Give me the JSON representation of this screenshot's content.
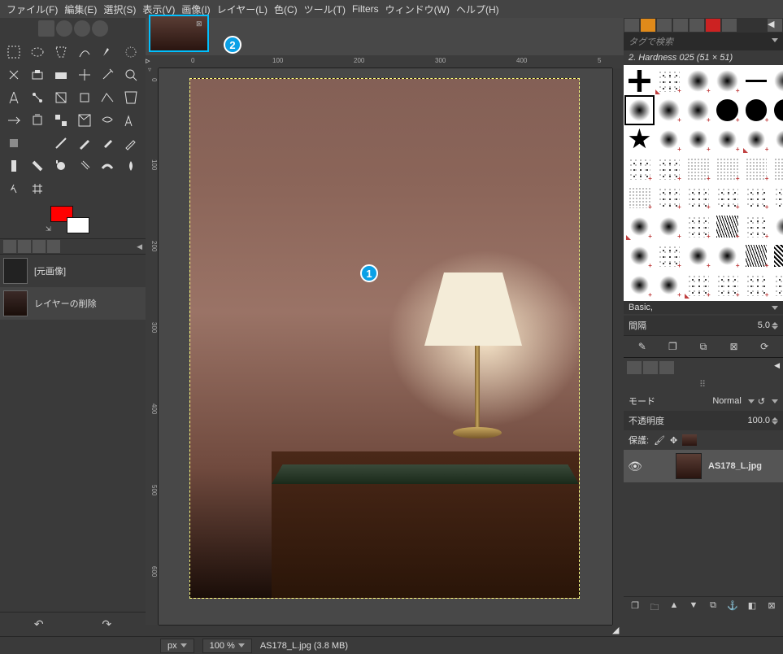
{
  "menu": [
    "ファイル(F)",
    "編集(E)",
    "選択(S)",
    "表示(V)",
    "画像(I)",
    "レイヤー(L)",
    "色(C)",
    "ツール(T)",
    "Filters",
    "ウィンドウ(W)",
    "ヘルプ(H)"
  ],
  "badges": {
    "b1": "1",
    "b2": "2"
  },
  "ruler_h": [
    "0",
    "100",
    "200",
    "300",
    "400",
    "5"
  ],
  "ruler_v": [
    "0",
    "100",
    "200",
    "300",
    "400",
    "500",
    "600"
  ],
  "status": {
    "unit": "px",
    "zoom": "100 %",
    "file": "AS178_L.jpg (3.8 MB)"
  },
  "left_layers": [
    {
      "label": "[元画像]",
      "blank": true
    },
    {
      "label": "レイヤーの削除",
      "blank": false
    }
  ],
  "right": {
    "tag_search": "タグで検索",
    "brush_info": "2. Hardness 025 (51 × 51)",
    "basic": "Basic,",
    "spacing_label": "間隔",
    "spacing_value": "5.0",
    "mode_label": "モード",
    "mode_value": "Normal",
    "opacity_label": "不透明度",
    "opacity_value": "100.0",
    "lock_label": "保護:",
    "layer_name": "AS178_L.jpg"
  },
  "brushes": [
    {
      "t": "b-pix"
    },
    {
      "t": "b-scatter",
      "p": 1,
      "tr": 1
    },
    {
      "t": "b-soft",
      "p": 1
    },
    {
      "t": "b-soft",
      "p": 1
    },
    {
      "t": "b-line"
    },
    {
      "t": "b-soft"
    },
    {
      "t": "b-soft",
      "sel": 1
    },
    {
      "t": "b-soft",
      "p": 1
    },
    {
      "t": "b-soft",
      "p": 1
    },
    {
      "t": "b-hard",
      "p": 1
    },
    {
      "t": "b-hard",
      "p": 1
    },
    {
      "t": "b-hard",
      "p": 1
    },
    {
      "t": "b-star"
    },
    {
      "t": "b-smudge",
      "p": 1
    },
    {
      "t": "b-smudge",
      "p": 1
    },
    {
      "t": "b-smudge",
      "p": 1
    },
    {
      "t": "b-smudge",
      "p": 1,
      "tr": 1
    },
    {
      "t": "b-smudge",
      "p": 1
    },
    {
      "t": "b-scatter",
      "p": 1
    },
    {
      "t": "b-scatter",
      "p": 1
    },
    {
      "t": "b-dots",
      "p": 1
    },
    {
      "t": "b-dots",
      "p": 1
    },
    {
      "t": "b-dots",
      "p": 1
    },
    {
      "t": "b-dots",
      "p": 1
    },
    {
      "t": "b-dots",
      "p": 1
    },
    {
      "t": "b-scatter",
      "p": 1
    },
    {
      "t": "b-scatter",
      "p": 1
    },
    {
      "t": "b-scatter",
      "p": 1
    },
    {
      "t": "b-scatter",
      "p": 1
    },
    {
      "t": "b-scatter",
      "p": 1
    },
    {
      "t": "b-smudge",
      "p": 1,
      "tr": 1
    },
    {
      "t": "b-smudge",
      "p": 1
    },
    {
      "t": "b-scatter",
      "p": 1
    },
    {
      "t": "b-lines",
      "p": 1
    },
    {
      "t": "b-scatter",
      "p": 1
    },
    {
      "t": "b-smudge",
      "p": 1
    },
    {
      "t": "b-smudge",
      "p": 1
    },
    {
      "t": "b-scatter",
      "p": 1
    },
    {
      "t": "b-smudge",
      "p": 1
    },
    {
      "t": "b-smudge",
      "p": 1
    },
    {
      "t": "b-lines",
      "p": 1
    },
    {
      "t": "b-diag",
      "p": 1
    },
    {
      "t": "b-smudge",
      "p": 1
    },
    {
      "t": "b-smudge",
      "p": 1
    },
    {
      "t": "b-scatter",
      "p": 1,
      "tr": 1
    },
    {
      "t": "b-scatter",
      "p": 1
    },
    {
      "t": "b-scatter",
      "p": 1
    },
    {
      "t": "b-scatter",
      "p": 1
    }
  ]
}
